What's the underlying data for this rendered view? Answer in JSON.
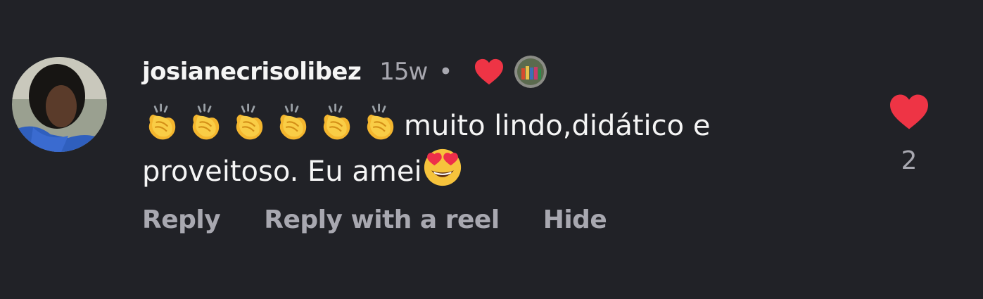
{
  "comment": {
    "username": "josianecrisolibez",
    "time": "15w",
    "separator": "•",
    "text_line1": "muito lindo,didático e",
    "text_line2": "proveitoso. Eu amei",
    "clap_count": 6,
    "emoji_end": "heart-eyes-emoji",
    "creator_liked": true
  },
  "actions": {
    "reply": "Reply",
    "reply_with_reel": "Reply with a reel",
    "hide": "Hide"
  },
  "likes": {
    "count": "2",
    "icon": "heart-icon",
    "liked": true
  },
  "colors": {
    "background": "#212227",
    "text_primary": "#f5f5f5",
    "text_secondary": "#a8a8b0",
    "heart": "#ee3445"
  }
}
